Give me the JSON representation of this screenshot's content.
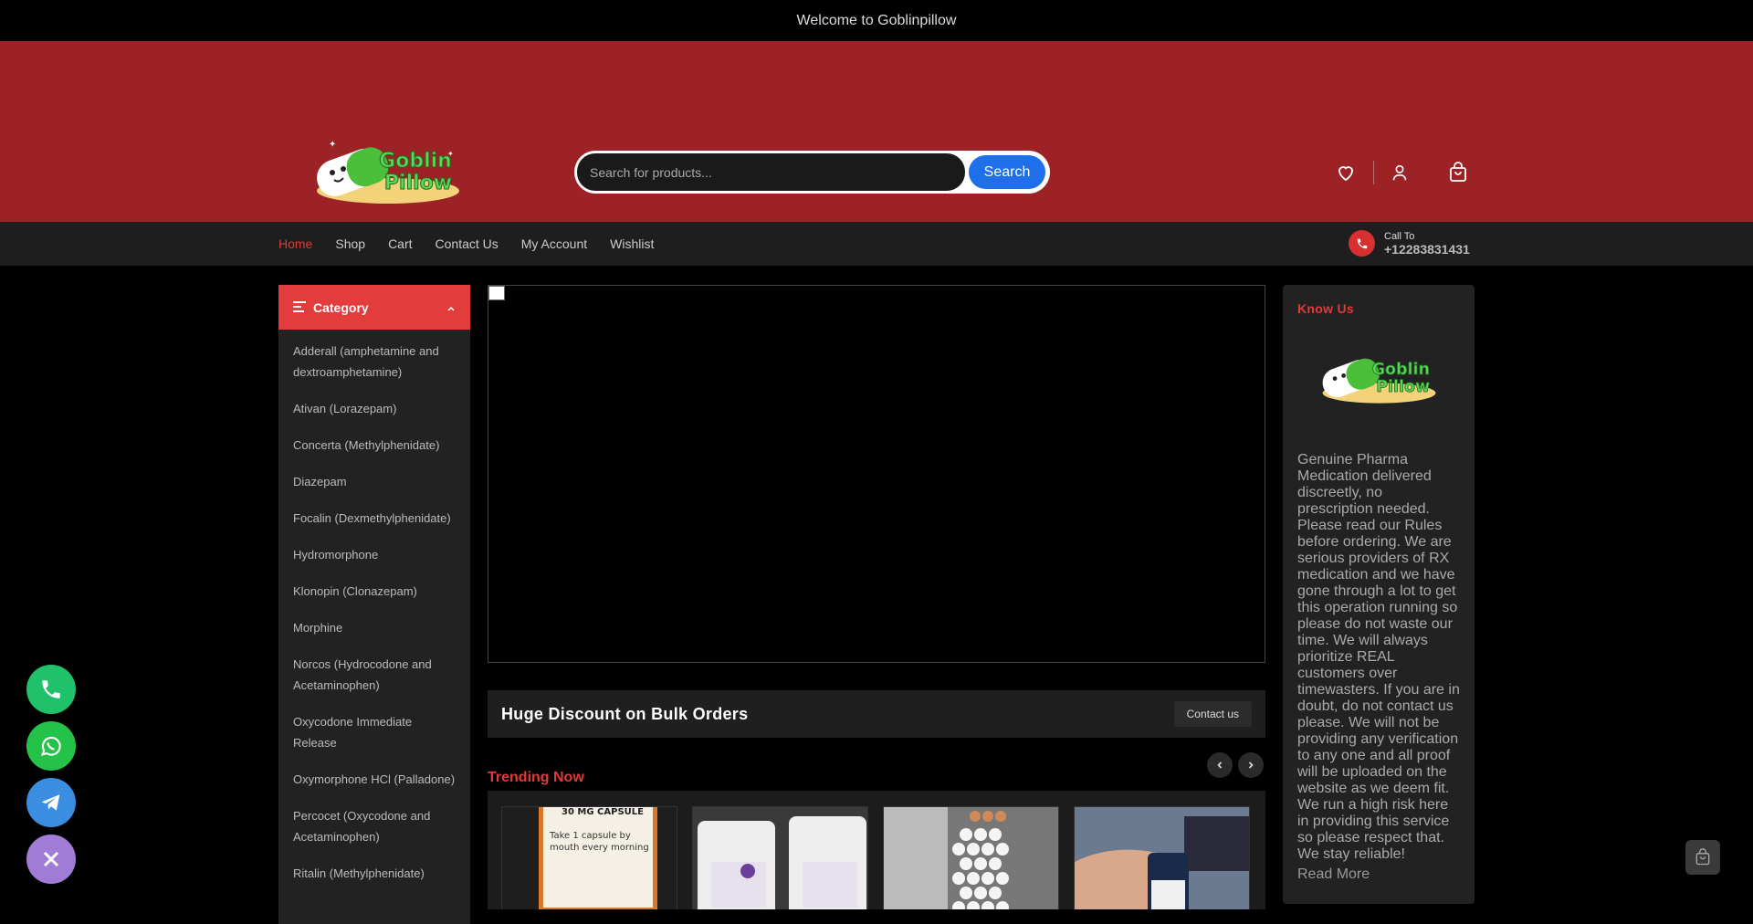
{
  "topbar": {
    "welcome": "Welcome to Goblinpillow"
  },
  "header": {
    "logo_alt": "Goblin Pillow",
    "search": {
      "placeholder": "Search for products...",
      "value": "",
      "button_label": "Search"
    },
    "icons": [
      "heart-icon",
      "user-icon",
      "shopping-bag-icon"
    ]
  },
  "nav": {
    "links": [
      {
        "label": "Home",
        "active": true
      },
      {
        "label": "Shop"
      },
      {
        "label": "Cart"
      },
      {
        "label": "Contact Us"
      },
      {
        "label": "My Account"
      },
      {
        "label": "Wishlist"
      }
    ],
    "call": {
      "label": "Call To",
      "number": "+12283831431"
    }
  },
  "sidebar": {
    "title": "Category",
    "items": [
      "Adderall (amphetamine and dextroamphetamine)",
      "Ativan (Lorazepam)",
      "Concerta (Methylphenidate)",
      "Diazepam",
      "Focalin (Dexmethylphenidate)",
      "Hydromorphone",
      "Klonopin (Clonazepam)",
      "Morphine",
      "Norcos (Hydrocodone and Acetaminophen)",
      "Oxycodone Immediate Release",
      "Oxymorphone HCl (Palladone)",
      "Percocet (Oxycodone and Acetaminophen)",
      "Ritalin (Methylphenidate)"
    ]
  },
  "main": {
    "discount_title": "Huge Discount on Bulk Orders",
    "contact_button": "Contact us",
    "trending_title": "Trending Now"
  },
  "know": {
    "title": "Know Us",
    "description": "Genuine Pharma Medication delivered discreetly, no prescription needed. Please read our Rules before ordering. We are serious providers of RX medication and we have gone through a lot to get this operation running so please do not waste our time. We will always prioritize REAL customers over timewasters. If you are in doubt, do not contact us please. We will not be providing any verification to any one and all proof will be uploaded on the website as we deem fit. We run a high risk here in providing this service so please respect that. We stay reliable!",
    "read_more": "Read More"
  },
  "products": {
    "label_text": "30 MG CAPSULE",
    "instruction": "Take 1 capsule by mouth every morning"
  },
  "colors": {
    "header_bg": "#9d2226",
    "accent": "#e03a3a",
    "search_btn": "#1f6feb"
  }
}
